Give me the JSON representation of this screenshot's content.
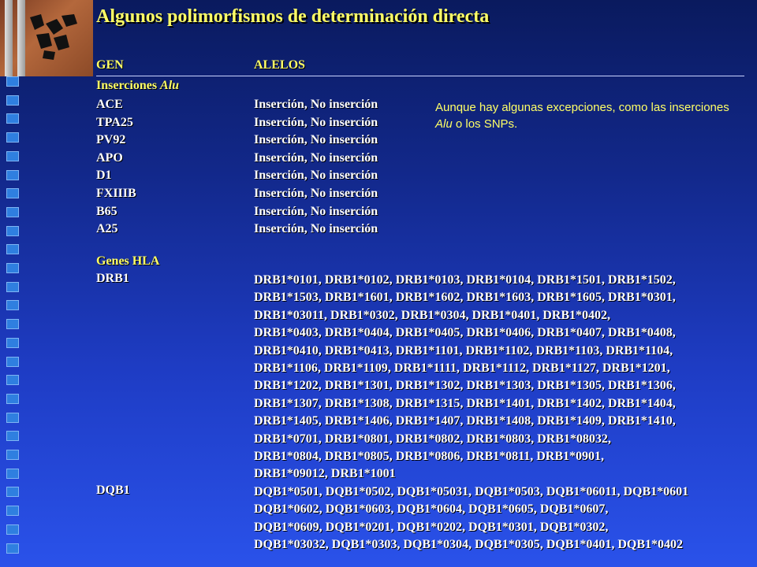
{
  "title": "Algunos polimorfismos de determinación directa",
  "header": {
    "gene": "GEN",
    "alleles": "ALELOS"
  },
  "sections": [
    {
      "label_pre": "Inserciones ",
      "label_em": "Alu"
    },
    {
      "label_pre": "Genes HLA",
      "label_em": ""
    }
  ],
  "insertions": [
    {
      "gene": "ACE",
      "alleles": "Inserción, No inserción"
    },
    {
      "gene": "TPA25",
      "alleles": "Inserción, No inserción"
    },
    {
      "gene": "PV92",
      "alleles": "Inserción, No inserción"
    },
    {
      "gene": "APO",
      "alleles": "Inserción, No inserción"
    },
    {
      "gene": "D1",
      "alleles": "Inserción, No inserción"
    },
    {
      "gene": "FXIIIB",
      "alleles": "Inserción, No inserción"
    },
    {
      "gene": "B65",
      "alleles": "Inserción, No inserción"
    },
    {
      "gene": "A25",
      "alleles": "Inserción, No inserción"
    }
  ],
  "hla": [
    {
      "gene": "DRB1",
      "lines": [
        "DRB1*0101, DRB1*0102, DRB1*0103, DRB1*0104, DRB1*1501, DRB1*1502,",
        "DRB1*1503, DRB1*1601, DRB1*1602, DRB1*1603, DRB1*1605, DRB1*0301,",
        "DRB1*03011, DRB1*0302, DRB1*0304, DRB1*0401, DRB1*0402,",
        "DRB1*0403, DRB1*0404, DRB1*0405, DRB1*0406, DRB1*0407, DRB1*0408,",
        "DRB1*0410, DRB1*0413, DRB1*1101, DRB1*1102, DRB1*1103, DRB1*1104,",
        "DRB1*1106, DRB1*1109, DRB1*1111, DRB1*1112, DRB1*1127, DRB1*1201,",
        "DRB1*1202, DRB1*1301, DRB1*1302, DRB1*1303, DRB1*1305, DRB1*1306,",
        "DRB1*1307, DRB1*1308, DRB1*1315, DRB1*1401, DRB1*1402, DRB1*1404,",
        "DRB1*1405, DRB1*1406, DRB1*1407, DRB1*1408, DRB1*1409, DRB1*1410,",
        "DRB1*0701, DRB1*0801, DRB1*0802, DRB1*0803, DRB1*08032,",
        "DRB1*0804, DRB1*0805, DRB1*0806, DRB1*0811, DRB1*0901,",
        "DRB1*09012, DRB1*1001"
      ]
    },
    {
      "gene": "DQB1",
      "lines": [
        "DQB1*0501, DQB1*0502, DQB1*05031, DQB1*0503, DQB1*06011, DQB1*0601",
        "DQB1*0602, DQB1*0603, DQB1*0604, DQB1*0605, DQB1*0607,",
        "DQB1*0609, DQB1*0201, DQB1*0202, DQB1*0301, DQB1*0302,",
        "DQB1*03032, DQB1*0303, DQB1*0304, DQB1*0305, DQB1*0401, DQB1*0402"
      ]
    }
  ],
  "note": {
    "text1": "Aunque hay algunas excepciones, como las inserciones ",
    "em": "Alu",
    "text2": " o los SNPs."
  },
  "colors": {
    "accent": "#ffff66",
    "background_top": "#0a1a5e",
    "background_bottom": "#2a52ea",
    "bullet": "#2f7fe0"
  },
  "icons": {
    "logo": "university-logo-icon",
    "bullets": "square-bullet-icon"
  }
}
